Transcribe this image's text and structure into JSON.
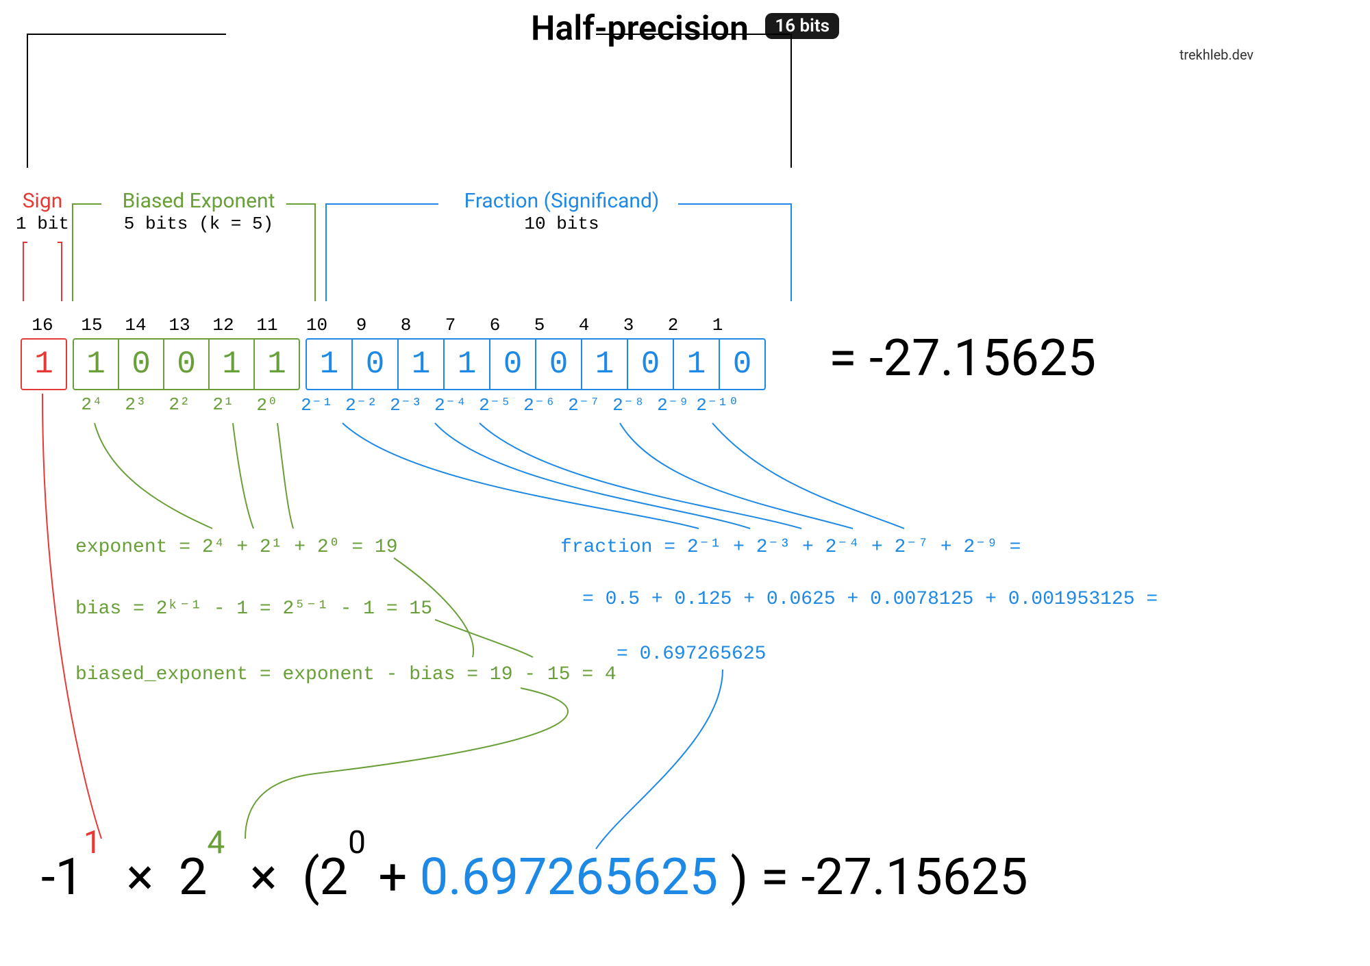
{
  "title": "Half-precision",
  "badge": "16 bits",
  "credit": "trekhleb.dev",
  "sections": {
    "sign": {
      "label": "Sign",
      "subtitle": "1 bit"
    },
    "exponent": {
      "label": "Biased Exponent",
      "subtitle": "5 bits (k = 5)"
    },
    "fraction": {
      "label": "Fraction (Significand)",
      "subtitle": "10 bits"
    }
  },
  "bit_indices": [
    "16",
    "15",
    "14",
    "13",
    "12",
    "11",
    "10",
    "9",
    "8",
    "7",
    "6",
    "5",
    "4",
    "3",
    "2",
    "1"
  ],
  "bits": {
    "sign": [
      "1"
    ],
    "exponent": [
      "1",
      "0",
      "0",
      "1",
      "1"
    ],
    "fraction": [
      "1",
      "0",
      "1",
      "1",
      "0",
      "0",
      "1",
      "0",
      "1",
      "0"
    ]
  },
  "powers": {
    "exponent": [
      "2⁴",
      "2³",
      "2²",
      "2¹",
      "2⁰"
    ],
    "fraction": [
      "2⁻¹",
      "2⁻²",
      "2⁻³",
      "2⁻⁴",
      "2⁻⁵",
      "2⁻⁶",
      "2⁻⁷",
      "2⁻⁸",
      "2⁻⁹",
      "2⁻¹⁰"
    ]
  },
  "decimal_value": "-27.15625",
  "calc": {
    "exp_line": "exponent = 2⁴ + 2¹ + 2⁰ = 19",
    "bias_line": "bias = 2ᵏ⁻¹ - 1 = 2⁵⁻¹ - 1 = 15",
    "biased_line": "biased_exponent = exponent - bias = 19 - 15 = 4",
    "frac_line1": "fraction = 2⁻¹ + 2⁻³ + 2⁻⁴ + 2⁻⁷ + 2⁻⁹ =",
    "frac_line2": "= 0.5 + 0.125 + 0.0625 + 0.0078125 + 0.001953125 =",
    "frac_line3": "= 0.697265625"
  },
  "formula": {
    "sign_exp": "1",
    "two_exp": "4",
    "mantissa_exp": "0",
    "fraction_val": "0.697265625",
    "result": "-27.15625"
  },
  "colors": {
    "sign": "#e53935",
    "exponent": "#689f38",
    "fraction": "#1e88e5"
  }
}
